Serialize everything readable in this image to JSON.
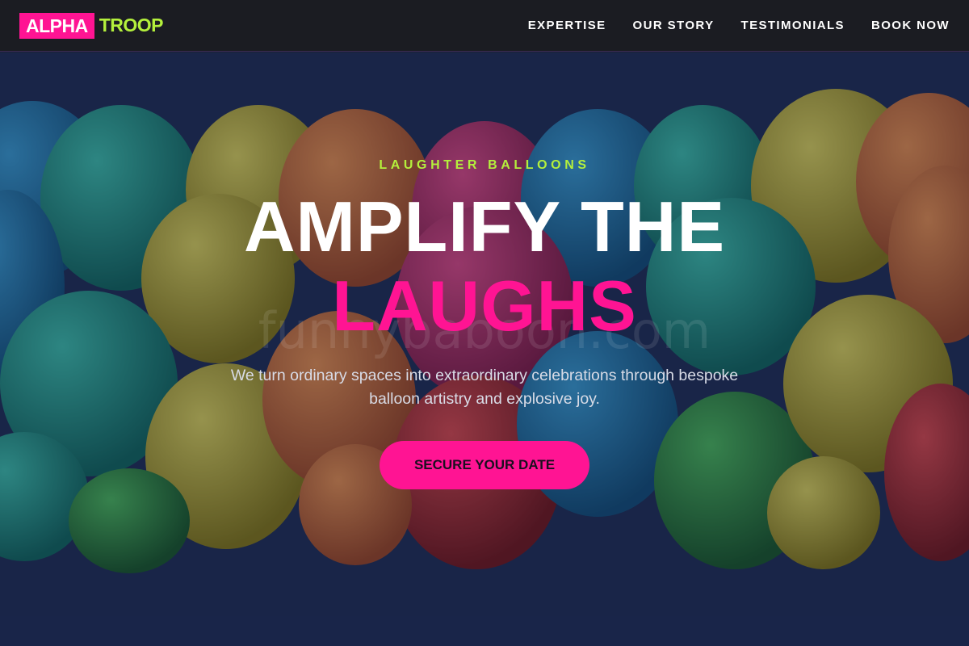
{
  "brand": {
    "logo_primary": "ALPHA",
    "logo_secondary": "TROOP",
    "accent_pink": "#ff1493",
    "accent_lime": "#b4f03c"
  },
  "nav": {
    "links": [
      {
        "label": "EXPERTISE"
      },
      {
        "label": "OUR STORY"
      },
      {
        "label": "TESTIMONIALS"
      },
      {
        "label": "BOOK NOW"
      }
    ]
  },
  "hero": {
    "eyebrow": "LAUGHTER BALLOONS",
    "headline_line1": "AMPLIFY THE",
    "headline_line2": "LAUGHS",
    "watermark": "funnybaboon.com",
    "subtext": "We turn ordinary spaces into extraordinary celebrations through bespoke balloon artistry and explosive joy.",
    "cta_label": "SECURE YOUR DATE"
  }
}
